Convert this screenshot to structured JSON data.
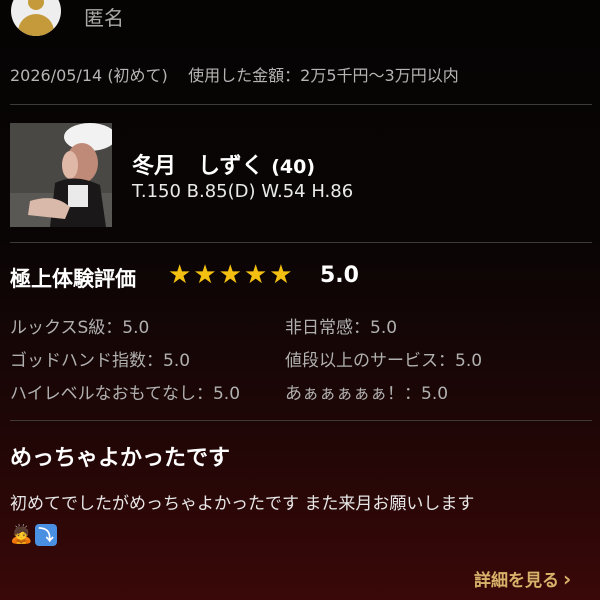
{
  "review": {
    "user": {
      "name": "匿名",
      "icon": "user-avatar-icon"
    },
    "meta": {
      "date": "2026/05/14",
      "visit_type": "(初めて)",
      "amount": "使用した金額：2万5千円〜3万円以内"
    },
    "cast": {
      "name": "冬月　しずく",
      "age": "(40)",
      "specs": "T.150 B.85(D) W.54 H.86"
    },
    "overall": {
      "label": "極上体験評価",
      "stars": 5,
      "score": "5.0",
      "star_color": "#f3c012"
    },
    "sub_ratings": [
      {
        "label": "ルックスS級：5.0"
      },
      {
        "label": "非日常感：5.0"
      },
      {
        "label": "ゴッドハンド指数：5.0"
      },
      {
        "label": "値段以上のサービス：5.0"
      },
      {
        "label": "ハイレベルなおもてなし：5.0"
      },
      {
        "label": "あぁぁぁぁぁ！：5.0"
      }
    ],
    "title": "めっちゃよかったです",
    "body": "初めてでしたがめっちゃよかったです また来月お願いします",
    "emojis": [
      "bowing-person-emoji",
      "down-arrow-emoji"
    ],
    "detail_link": "詳細を見る",
    "accent_color": "#d8b26a"
  }
}
